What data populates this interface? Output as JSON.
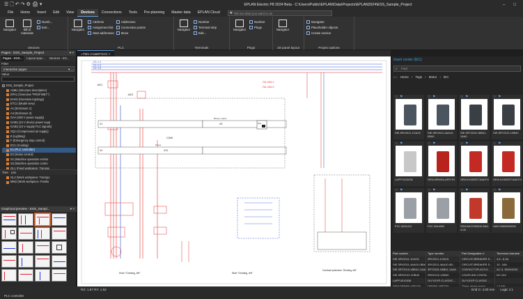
{
  "app": {
    "title": "EPLAN Electric P8 2024 Beta - C:\\Users\\Public\\EPLAN\\Data\\Projects\\EPLAN2024\\ESS_Sample_Project",
    "quick_access": [
      "☰",
      "🗋",
      "↶",
      "↷",
      "⚙",
      "🖨",
      "▾"
    ],
    "window_controls": [
      "–",
      "□"
    ]
  },
  "menu": {
    "items": [
      "File",
      "Home",
      "Insert",
      "Edit",
      "View",
      "Devices",
      "Connections",
      "Tools",
      "Pre-planning",
      "Master data",
      "EPLAN Cloud"
    ],
    "active": "Devices",
    "tellme_placeholder": "Tell me what you want to do"
  },
  "ribbon": {
    "groups": [
      {
        "label": "Devices",
        "big": [
          "Navigator",
          "Bill of materials"
        ],
        "small": [
          "Numb...",
          "Extr..."
        ]
      },
      {
        "label": "PLC",
        "big": [
          "Navigator"
        ],
        "small": [
          "Address",
          "Assignment list",
          "Start addresses",
          "Addresses",
          "Connection points",
          "Move"
        ]
      },
      {
        "label": "Terminals",
        "big": [
          "Navigator"
        ],
        "small": [
          "Number",
          "Terminal strip",
          "Edit..."
        ]
      },
      {
        "label": "Plugs",
        "big": [
          "Navigator"
        ],
        "small": [
          "Number",
          "Plugs"
        ]
      },
      {
        "label": "2D panel layout",
        "big": [
          "Navigator"
        ],
        "small": []
      },
      {
        "label": "Project options",
        "big": [],
        "small": [
          "Navigator",
          "Placeholder objects",
          "Create section"
        ]
      }
    ]
  },
  "left_panel": {
    "header": "Pages - ESS_Sample_Project",
    "tabs": [
      "Pages - ESS...",
      "Layout spac...",
      "Devices - ES..."
    ],
    "filter_label": "Filter",
    "filter_value": "Interactive pages",
    "value_label": "Value",
    "tree_root": "ESS_Sample_Project",
    "tree_items": [
      "ADB1 (Structure description)",
      "EPA1 (Overview \"PROFINET\")",
      "EHA0 (Overview topology)",
      "ETC1 (Model view)",
      "A1 (Enclosure 1)",
      "A4 (Enclosure 3)",
      "GAA (400 V power supply)",
      "GAB1 (24 V device power supp",
      "GAB2 (24 V supply PLC signals)",
      "GQA (Compressed air supply)",
      "E (Lighting)",
      "F (Emergency stop control)",
      "EC1 (Cooling)",
      "K1 (PLC controller)",
      "E2 (Noise control)",
      "S1 (Machine operation enclos",
      "S2 (Machine operation contro",
      "GL1 (Feed workpiece: Transpo",
      "MM1 (Feed workpiece: Positio",
      "GL2 (Work workpiece: Transpo",
      "MM2 (Work workpiece: Positio"
    ],
    "selected_index": 13,
    "tree_tabs": [
      "Tree",
      "List"
    ],
    "preview_header": "Graphical preview - ESS_Sampl..."
  },
  "document": {
    "tab_label": "=TM1+A1&EFS1/1"
  },
  "schematic": {
    "labels": {
      "top_l1": "-X1 / L1",
      "top_l2": "-X1 / L2",
      "top_l3": "-X1 / L3",
      "xq": "-TA1-X512.1",
      "xq2": "-TA1-X512.2",
      "mc1": "-MC1",
      "mc2": "-MC2",
      "x1": "X1",
      "x12": "X12",
      "x2": "X2",
      "x5": "X5",
      "s11": "S11",
      "binary": "Binary modes",
      "power": "Power",
      "center": "2,2kW",
      "rail": "Drive \"Grinding, left\"",
      "start": "Start \"Grinding, left\"",
      "overload": "Overload protection \"Grinding, left\"",
      "coord": "RX: 1.87  RY: 1.52"
    }
  },
  "right_panel": {
    "header": "Insert center (IEC)",
    "find_placeholder": "Find",
    "breadcrumb": [
      "Home",
      "Tags",
      "Motor",
      "IEC"
    ],
    "parts": [
      {
        "caption": "SIE.3RV2011-1GA15"
      },
      {
        "caption": "SIE.3RV2011-4AA10-0BA0"
      },
      {
        "caption": "SIE.3RT2015-1BB41-1AA0"
      },
      {
        "caption": "SIE.3RT2122-1HB40"
      },
      {
        "caption": "LAPP.0010036"
      },
      {
        "caption": "SEW.DRN90L4/FE/TH"
      },
      {
        "caption": "SEW.K19DRS71M4/TH"
      },
      {
        "caption": "SEW.K19DRS71M4/TH"
      },
      {
        "caption": "PXC.3031212"
      },
      {
        "caption": "PXC.3044092"
      },
      {
        "caption": "SEW.MC07B0015-5A3-4-00"
      },
      {
        "caption": "HAR.09620035031"
      }
    ],
    "table_headers": [
      "Part number",
      "Type number",
      "Part Designation 1",
      "Technical characte"
    ],
    "table_rows": [
      [
        "SIE.3RV2011-1GA15",
        "3RV2011-1GA15",
        "CIRCUIT-BREAKER S...",
        "4,5...6,3A"
      ],
      [
        "SIE.3RV2011-4AA10-0BA0",
        "3RV2011-4AA10-0B...",
        "CIRCUIT-BREAKER S...",
        "10...16A"
      ],
      [
        "SIE.3RT2015-1BB41-1AA0",
        "3RT2015-1BB41-1AA0",
        "CONTACTOR,AC3:3...",
        "AC-3, 3KW/400V,"
      ],
      [
        "SIE.3RH2122-1HB40",
        "3RH2122-1HB40",
        "COUPLING CONTA...",
        "DC 24V"
      ],
      [
        "LAPP.0010036",
        "OLFLEX® CLASSIC...",
        "OLFLEX® CLASSIC ...",
        ""
      ],
      [
        "SEW.DRN90L4/FE/TH",
        "DRN90L4/FE/TH",
        "Three-phase motor",
        "1,5 kW"
      ]
    ]
  },
  "status": {
    "coordinates": "RX: 1.87  RY: 1.52",
    "grid": "Grid C: 4.00 mm",
    "logic": "Logic 1:1",
    "bottom_left": "PLC controller"
  },
  "colors": {
    "accent": "#3aa3e0",
    "selection": "#345a86",
    "wire_red": "#e03030",
    "wire_blue": "#2e4fd0"
  }
}
